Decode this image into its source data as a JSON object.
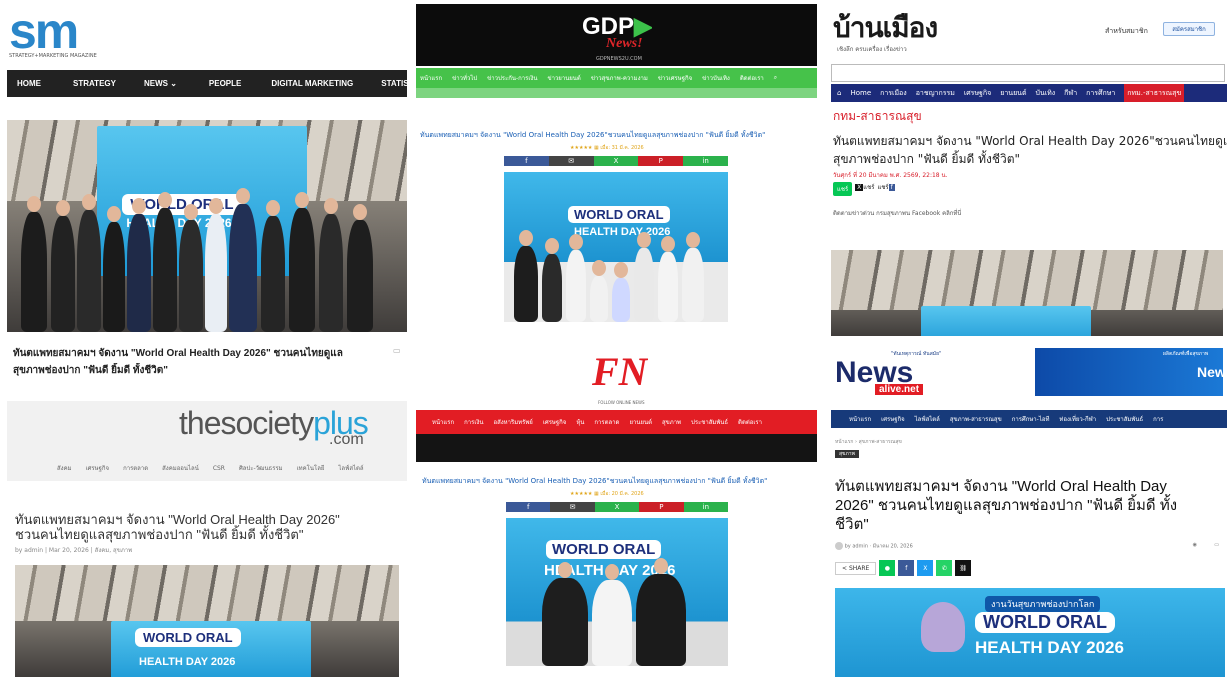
{
  "headline": "ทันตแพทยสมาคมฯ จัดงาน \"World Oral Health Day 2026\" ชวนคนไทยดูแลสุขภาพช่องปาก \"ฟันดี ยิ้มดี ทั้งชีวิต\"",
  "event": {
    "line1": "WORLD ORAL",
    "line2": "HEALTH DAY 2026",
    "small": "งานวันสุขภาพช่องปากโลก"
  },
  "sm": {
    "logo": "sm",
    "tagline": "STRATEGY+MARKETING MAGAZINE",
    "nav": [
      "HOME",
      "STRATEGY",
      "NEWS",
      "PEOPLE",
      "DIGITAL MARKETING",
      "STATISTI"
    ],
    "headline_l1": "ทันตแพทยสมาคมฯ จัดงาน \"World Oral Health Day 2026\" ชวนคนไทยดูแล",
    "headline_l2": "สุขภาพช่องปาก \"ฟันดี ยิ้มดี ทั้งชีวิต\""
  },
  "gdp": {
    "logo_main": "GDP",
    "logo_sub": "News!",
    "domain": "GDPNEWS2U.COM",
    "nav": [
      "หน้าแรก",
      "ข่าวทั่วไป",
      "ข่าวประกัน-การเงิน",
      "ข่าวยานยนต์",
      "ข่าวสุขภาพ-ความงาม",
      "ข่าวเศรษฐกิจ",
      "ข่าวบันเทิง",
      "ติดต่อเรา"
    ],
    "title": "ทันตแพทยสมาคมฯ จัดงาน \"World Oral Health Day 2026\"ชวนคนไทยดูแลสุขภาพช่องปาก \"ฟันดี ยิ้มดี ทั้งชีวิต\"",
    "meta": "★★★★★  ▦ เมื่อ: 31 มี.ค. 2026",
    "share": [
      "f",
      "✉",
      "X",
      "P",
      "in"
    ]
  },
  "bannmuang": {
    "logo": "บ้านเมือง",
    "tagline": "เชิงลึก ครบเครื่อง เรื่องข่าว",
    "member": "สำหรับสมาชิก",
    "subscribe": "สมัครสมาชิก",
    "nav": [
      "Home",
      "การเมือง",
      "อาชญากรรม",
      "เศรษฐกิจ",
      "ยานยนต์",
      "บันเทิง",
      "กีฬา",
      "การศึกษา",
      "กทม.-สาธารณสุข"
    ],
    "section": "กทม-สาธารณสุข",
    "title_l1": "ทันตแพทยสมาคมฯ จัดงาน \"World Oral Health Day 2026\"ชวนคนไทยดูแล",
    "title_l2": "สุขภาพช่องปาก \"ฟันดี ยิ้มดี ทั้งชีวิต\"",
    "date": "วันศุกร์ ที่ 20 มีนาคม พ.ศ. 2569, 22:18 น.",
    "shares": [
      "แชร์",
      "แชร์",
      "แชร์"
    ],
    "byline": "ติดตามข่าวด่วน กรมสุขภาพน Facebook คลิกที่นี่"
  },
  "societyplus": {
    "logo_a": "thesociety",
    "logo_b": "plus",
    "logo_c": ".com",
    "nav": [
      "สังคม",
      "เศรษฐกิจ",
      "การตลาด",
      "สังคมออนไลน์",
      "CSR",
      "ศิลปะ-วัฒนธรรม",
      "เทคโนโลยี",
      "ไลฟ์สไตล์"
    ],
    "title_l1": "ทันตแพทยสมาคมฯ จัดงาน \"World Oral Health Day 2026\"",
    "title_l2": "ชวนคนไทยดูแลสุขภาพช่องปาก \"ฟันดี ยิ้มดี ทั้งชีวิต\"",
    "meta": "by admin | Mar 20, 2026 | สังคม, สุขภาพ"
  },
  "fn": {
    "logo": "FN",
    "sub": "FOLLOW ONLINE NEWS",
    "nav": [
      "หน้าแรก",
      "การเงิน",
      "อสังหาริมทรัพย์",
      "เศรษฐกิจ",
      "หุ้น",
      "การตลาด",
      "ยานยนต์",
      "สุขภาพ",
      "ประชาสัมพันธ์",
      "ติดต่อเรา"
    ],
    "title": "ทันตแพทยสมาคมฯ จัดงาน \"World Oral Health Day 2026\"ชวนคนไทยดูแลสุขภาพช่องปาก \"ฟันดี ยิ้มดี ทั้งชีวิต\"",
    "meta": "★★★★★  ▦ เมื่อ: 20 มี.ค. 2026",
    "share": [
      "f",
      "✉",
      "X",
      "P",
      "in"
    ]
  },
  "newsalive": {
    "logo_a": "News",
    "logo_b": "alive.net",
    "slogan": "\"ทันเหตุการณ์ ทันสมัย\"",
    "nav": [
      "หน้าแรก",
      "เศรษฐกิจ",
      "ไลฟ์สไตล์",
      "สุขภาพ-สาธารณสุข",
      "การศึกษา-ไอที",
      "ท่องเที่ยว-กีฬา",
      "ประชาสัมพันธ์",
      "การ"
    ],
    "breadcrumb": "หน้าแรก › สุขภาพ-สาธารณสุข",
    "tag": "สุขภาพ",
    "title_l1": "ทันตแพทยสมาคมฯ จัดงาน \"World Oral Health Day",
    "title_l2": "2026\" ชวนคนไทยดูแลสุขภาพช่องปาก \"ฟันดี ยิ้มดี ทั้ง",
    "title_l3": "ชีวิต\"",
    "author": "by admin  · มีนาคม 20, 2026",
    "share_label": "SHARE",
    "ad_title": "ผลิตภัณฑ์เพื่อสุขภาพ",
    "event_line": "งานวันสุขภาพช่องปากโลก"
  },
  "colors": {
    "brand_blue": "#1d9ad6",
    "gdp_green": "#46c24a",
    "fn_red": "#e21d24",
    "bm_navy": "#1c2b7a",
    "bm_red": "#d81e2a",
    "na_navy": "#173a7a"
  }
}
